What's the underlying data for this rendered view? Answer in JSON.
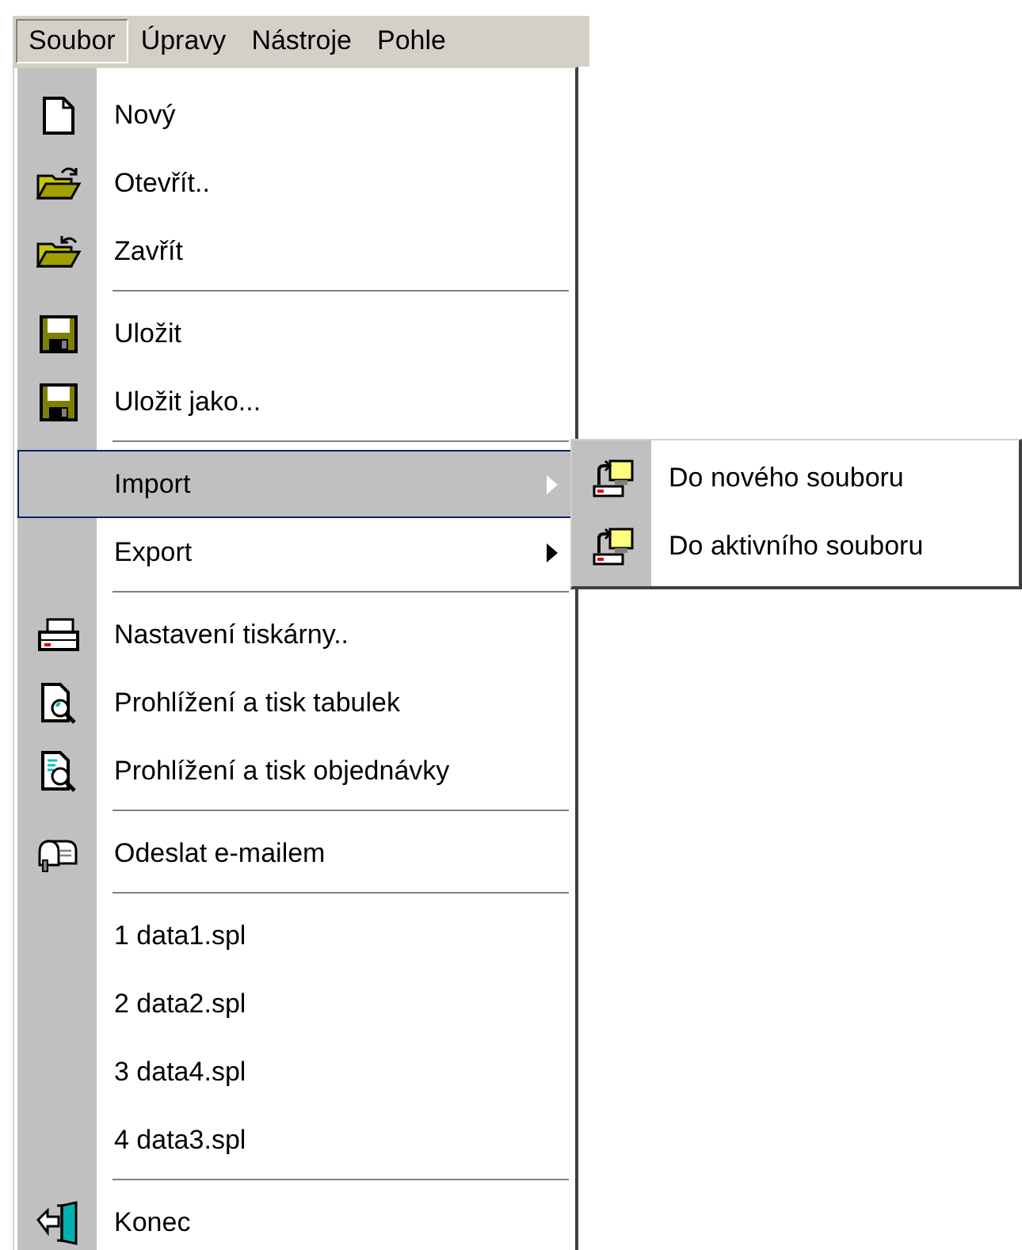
{
  "menu_bar": [
    {
      "label": "Soubor",
      "selected": true
    },
    {
      "label": "Úpravy",
      "selected": false
    },
    {
      "label": "Nástroje",
      "selected": false
    },
    {
      "label": "Pohle",
      "selected": false
    }
  ],
  "menu": {
    "items": [
      {
        "kind": "item",
        "label": "Nový",
        "selected": false
      },
      {
        "kind": "item",
        "label": "Otevřít..",
        "selected": false
      },
      {
        "kind": "item",
        "label": "Zavřít",
        "selected": false
      },
      {
        "kind": "separator"
      },
      {
        "kind": "item",
        "label": "Uložit",
        "selected": false
      },
      {
        "kind": "item",
        "label": "Uložit jako...",
        "selected": false
      },
      {
        "kind": "separator"
      },
      {
        "kind": "submenu",
        "label": "Import",
        "selected": true,
        "expanded": true,
        "items": [
          {
            "kind": "item",
            "label": "Do nového souboru",
            "selected": false
          },
          {
            "kind": "item",
            "label": "Do aktivního souboru",
            "selected": false
          }
        ]
      },
      {
        "kind": "submenu",
        "label": "Export",
        "selected": false,
        "expanded": false
      },
      {
        "kind": "separator"
      },
      {
        "kind": "item",
        "label": "Nastavení tiskárny..",
        "selected": false
      },
      {
        "kind": "item",
        "label": "Prohlížení a tisk tabulek",
        "selected": false
      },
      {
        "kind": "item",
        "label": "Prohlížení a tisk objednávky",
        "selected": false
      },
      {
        "kind": "separator"
      },
      {
        "kind": "item",
        "label": "Odeslat e-mailem",
        "selected": false
      },
      {
        "kind": "separator"
      },
      {
        "kind": "item",
        "label": "1 data1.spl",
        "selected": false
      },
      {
        "kind": "item",
        "label": "2 data2.spl",
        "selected": false
      },
      {
        "kind": "item",
        "label": "3 data4.spl",
        "selected": false
      },
      {
        "kind": "item",
        "label": "4 data3.spl",
        "selected": false
      },
      {
        "kind": "separator"
      },
      {
        "kind": "item",
        "label": "Konec",
        "selected": false
      }
    ]
  }
}
